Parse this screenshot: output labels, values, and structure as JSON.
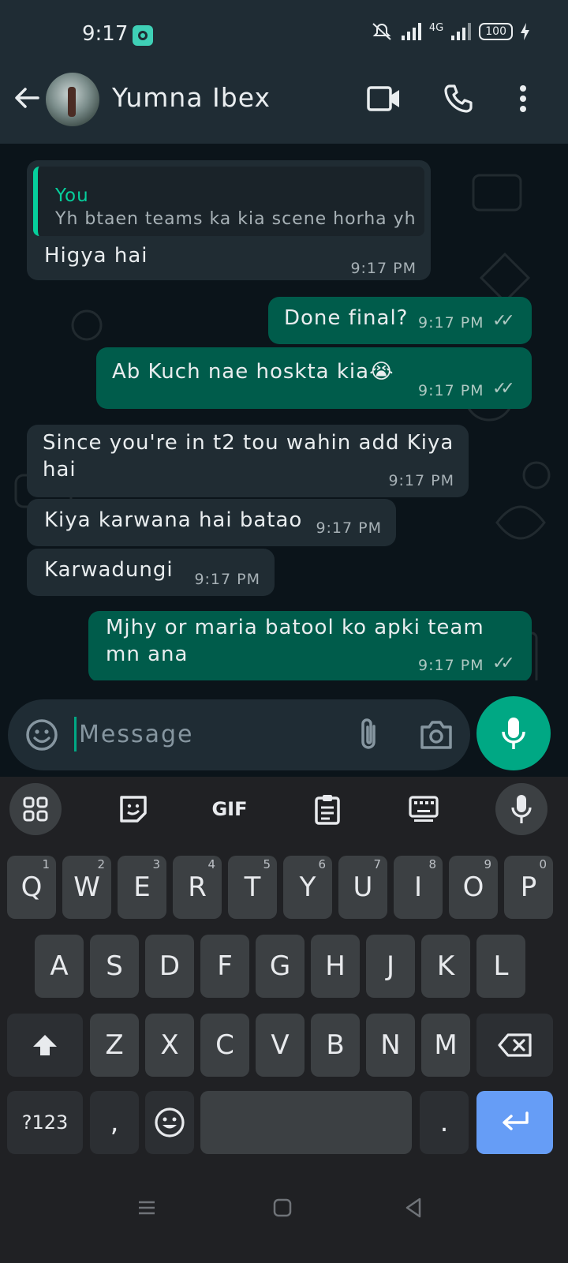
{
  "status_bar": {
    "time": "9:17",
    "network": "4G",
    "battery": "100"
  },
  "header": {
    "contact_name": "Yumna Ibex"
  },
  "messages": [
    {
      "direction": "in",
      "quote_author": "You",
      "quote_text": "Yh btaen teams ka kia scene horha yh",
      "text": "Higya hai",
      "time": "9:17 PM"
    },
    {
      "direction": "out",
      "text": "Done final?",
      "time": "9:17 PM",
      "ticks": "✓✓"
    },
    {
      "direction": "out",
      "text": "Ab Kuch nae hoskta kia😭",
      "time": "9:17 PM",
      "ticks": "✓✓"
    },
    {
      "direction": "in",
      "text_line1": "Since you're in t2 tou wahin add Kiya",
      "text_line2": "hai",
      "time": "9:17 PM"
    },
    {
      "direction": "in",
      "text": "Kiya karwana hai batao",
      "time": "9:17 PM"
    },
    {
      "direction": "in",
      "text": "Karwadungi",
      "time": "9:17 PM"
    },
    {
      "direction": "out",
      "text_line1": "Mjhy or maria batool ko apki team",
      "text_line2": "mn ana",
      "time": "9:17 PM",
      "ticks": "✓✓"
    }
  ],
  "composer": {
    "placeholder": "Message"
  },
  "keyboard": {
    "toolbar_gif": "GIF",
    "row1": [
      {
        "label": "Q",
        "hint": "1"
      },
      {
        "label": "W",
        "hint": "2"
      },
      {
        "label": "E",
        "hint": "3"
      },
      {
        "label": "R",
        "hint": "4"
      },
      {
        "label": "T",
        "hint": "5"
      },
      {
        "label": "Y",
        "hint": "6"
      },
      {
        "label": "U",
        "hint": "7"
      },
      {
        "label": "I",
        "hint": "8"
      },
      {
        "label": "O",
        "hint": "9"
      },
      {
        "label": "P",
        "hint": "0"
      }
    ],
    "row2": [
      "A",
      "S",
      "D",
      "F",
      "G",
      "H",
      "J",
      "K",
      "L"
    ],
    "row3": [
      "Z",
      "X",
      "C",
      "V",
      "B",
      "N",
      "M"
    ],
    "symbols": "?123",
    "comma": ",",
    "period": "."
  },
  "colors": {
    "outgoing": "#005c4b",
    "incoming": "#202c33",
    "accent": "#00a884",
    "enter_key": "#669df6"
  }
}
